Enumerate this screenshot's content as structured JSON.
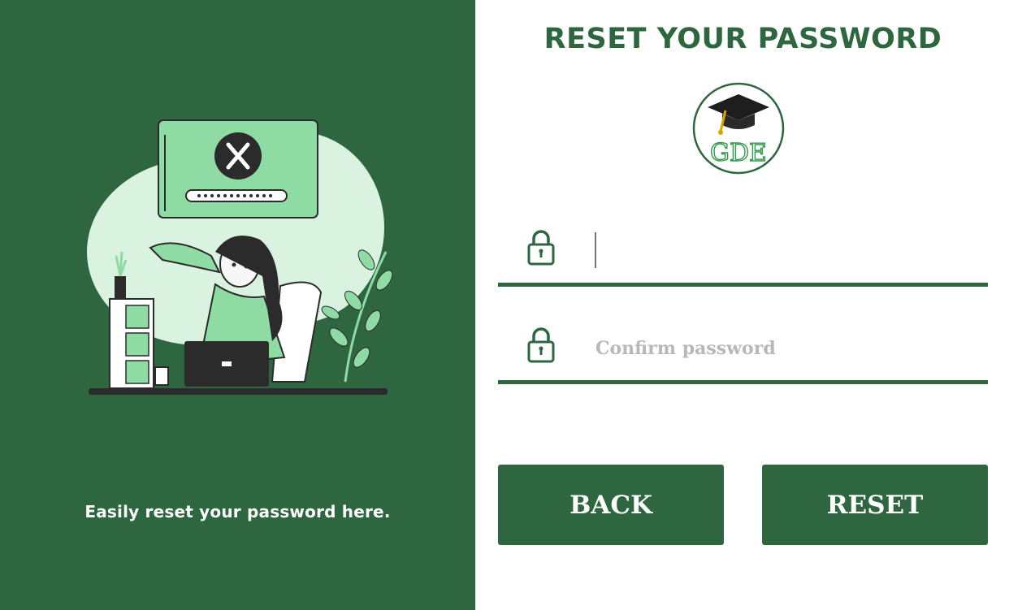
{
  "left_panel": {
    "tagline": "Easily reset your password here."
  },
  "form": {
    "title": "RESET YOUR PASSWORD",
    "logo_text": "GDE",
    "password_field": {
      "value": "",
      "placeholder": ""
    },
    "confirm_field": {
      "value": "",
      "placeholder": "Confirm password"
    },
    "back_label": "BACK",
    "reset_label": "RESET"
  },
  "icons": {
    "field_icon": "lock-icon",
    "logo_icon": "graduation-cap-icon",
    "popup_icon": "close-x-icon"
  },
  "colors": {
    "brand_green": "#2e6640",
    "light_green": "#8fdba4",
    "pale_green": "#d9f3e0",
    "white": "#ffffff",
    "placeholder_gray": "#b8b8b8"
  }
}
